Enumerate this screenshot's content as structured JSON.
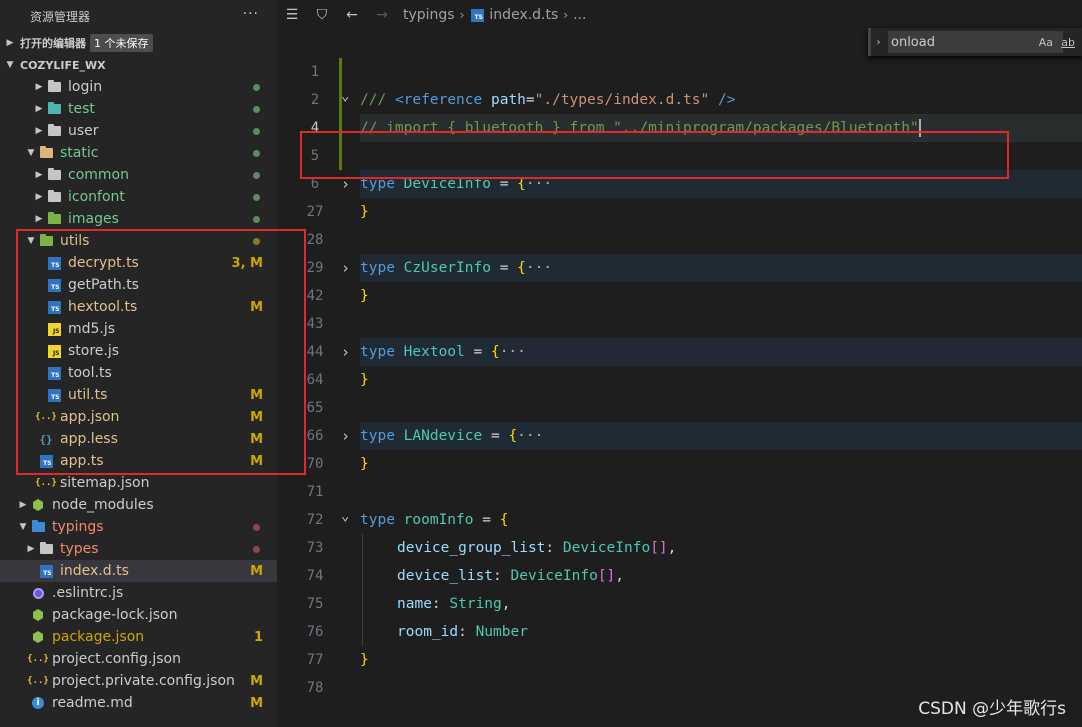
{
  "sidebar": {
    "title": "资源管理器",
    "more": "···",
    "open_editors": {
      "label": "打开的编辑器",
      "badge": "1 个未保存"
    },
    "project": "COZYLIFE_WX",
    "tree": [
      {
        "label": "login",
        "color": "",
        "status": "dot",
        "dot": "green"
      },
      {
        "label": "test",
        "color": "green",
        "status": "dot",
        "dot": "green"
      },
      {
        "label": "user",
        "color": "",
        "status": "dot",
        "dot": "green"
      },
      {
        "label": "static",
        "color": "green",
        "status": "dot",
        "dot": "green"
      },
      {
        "label": "common",
        "color": "green",
        "status": "dot",
        "dot": "green"
      },
      {
        "label": "iconfont",
        "color": "green",
        "status": "dot",
        "dot": "green"
      },
      {
        "label": "images",
        "color": "green",
        "status": "dot",
        "dot": "green"
      },
      {
        "label": "utils",
        "color": "yellow",
        "status": "dot",
        "dot": "olive"
      },
      {
        "label": "decrypt.ts",
        "color": "yellow",
        "status": "text",
        "status_text": "3, M"
      },
      {
        "label": "getPath.ts",
        "color": "",
        "status": "none"
      },
      {
        "label": "hextool.ts",
        "color": "yellow",
        "status": "text",
        "status_text": "M"
      },
      {
        "label": "md5.js",
        "color": "",
        "status": "none"
      },
      {
        "label": "store.js",
        "color": "",
        "status": "none"
      },
      {
        "label": "tool.ts",
        "color": "",
        "status": "none"
      },
      {
        "label": "util.ts",
        "color": "yellow",
        "status": "text",
        "status_text": "M"
      },
      {
        "label": "app.json",
        "color": "yellow",
        "status": "text",
        "status_text": "M"
      },
      {
        "label": "app.less",
        "color": "yellow",
        "status": "text",
        "status_text": "M"
      },
      {
        "label": "app.ts",
        "color": "yellow",
        "status": "text",
        "status_text": "M"
      },
      {
        "label": "sitemap.json",
        "color": "",
        "status": "none"
      },
      {
        "label": "node_modules",
        "color": "",
        "status": "none"
      },
      {
        "label": "typings",
        "color": "red",
        "status": "dot",
        "dot": "red"
      },
      {
        "label": "types",
        "color": "red",
        "status": "dot",
        "dot": "red"
      },
      {
        "label": "index.d.ts",
        "color": "yellow",
        "status": "text",
        "status_text": "M"
      },
      {
        "label": ".eslintrc.js",
        "color": "",
        "status": "none"
      },
      {
        "label": "package-lock.json",
        "color": "",
        "status": "none"
      },
      {
        "label": "package.json",
        "color": "olive",
        "status": "text",
        "status_text": "1"
      },
      {
        "label": "project.config.json",
        "color": "",
        "status": "none"
      },
      {
        "label": "project.private.config.json",
        "color": "",
        "status": "text",
        "status_text": "M"
      },
      {
        "label": "readme.md",
        "color": "",
        "status": "text",
        "status_text": "M"
      }
    ]
  },
  "breadcrumb": {
    "folder": "typings",
    "file": "index.d.ts",
    "tail": "..."
  },
  "find": {
    "value": "onload",
    "match_case": "Aa",
    "whole_word": "ab"
  },
  "editor": {
    "lines": [
      {
        "n": "1"
      },
      {
        "n": "2"
      },
      {
        "n": "4"
      },
      {
        "n": "5"
      },
      {
        "n": "6"
      },
      {
        "n": "27"
      },
      {
        "n": "28"
      },
      {
        "n": "29"
      },
      {
        "n": "42"
      },
      {
        "n": "43"
      },
      {
        "n": "44"
      },
      {
        "n": "64"
      },
      {
        "n": "65"
      },
      {
        "n": "66"
      },
      {
        "n": "70"
      },
      {
        "n": "71"
      },
      {
        "n": "72"
      },
      {
        "n": "73"
      },
      {
        "n": "74"
      },
      {
        "n": "75"
      },
      {
        "n": "76"
      },
      {
        "n": "77"
      },
      {
        "n": "78"
      }
    ],
    "ref_line": {
      "slashes": "///",
      "tag_open": "<reference",
      "attr": "path",
      "eq": "=",
      "val": "\"./types/index.d.ts\"",
      "tag_close": "/>"
    },
    "comment_line": "// import { bluetooth } from \"../miniprogram/packages/Bluetooth\"",
    "types": [
      {
        "kw": "type",
        "name": "DeviceInfo",
        "rest": " = {",
        "ell": "···"
      },
      {
        "kw": "type",
        "name": "CzUserInfo",
        "rest": " = {",
        "ell": "···"
      },
      {
        "kw": "type",
        "name": "Hextool",
        "rest": " = {",
        "ell": "···"
      },
      {
        "kw": "type",
        "name": "LANdevice",
        "rest": " = {",
        "ell": "···"
      }
    ],
    "close": "}",
    "room": {
      "kw": "type",
      "name": "roomInfo",
      "rest": " = {",
      "fields": [
        {
          "key": "device_group_list",
          "sep": ": ",
          "type": "DeviceInfo",
          "arr": "[]",
          "end": ","
        },
        {
          "key": "device_list",
          "sep": ": ",
          "type": "DeviceInfo",
          "arr": "[]",
          "end": ","
        },
        {
          "key": "name",
          "sep": ": ",
          "type": "String",
          "arr": "",
          "end": ","
        },
        {
          "key": "room_id",
          "sep": ": ",
          "type": "Number",
          "arr": "",
          "end": ""
        }
      ]
    }
  },
  "watermark": "CSDN @少年歌行s"
}
